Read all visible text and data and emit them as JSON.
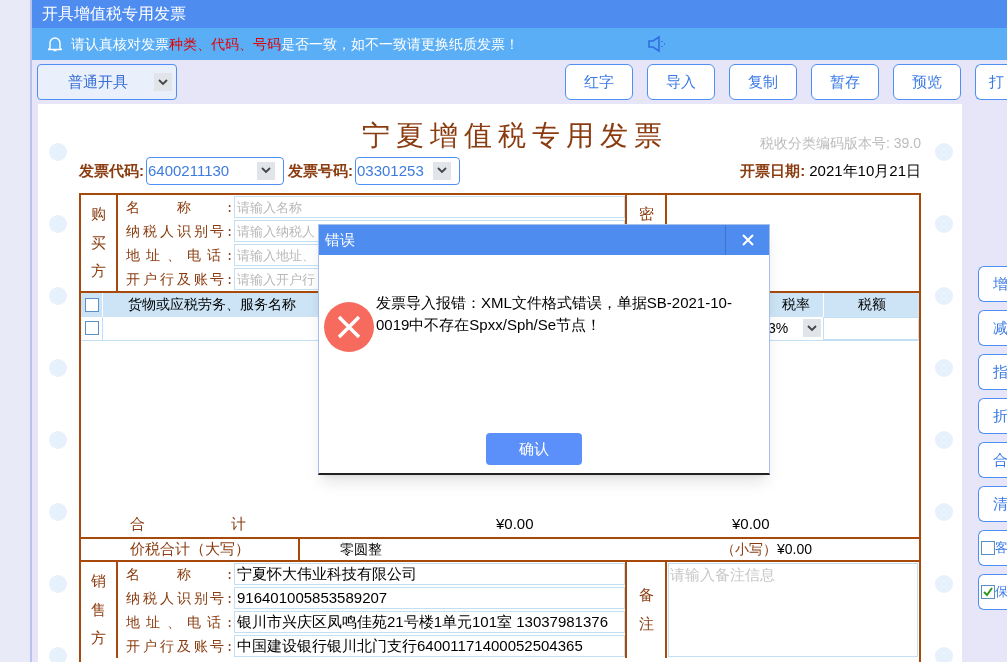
{
  "window": {
    "title": "开具增值税专用发票"
  },
  "notice": {
    "parts": [
      {
        "text": "请认真核对发票",
        "highlight": false
      },
      {
        "text": "种类、代码、号码",
        "highlight": true
      },
      {
        "text": "是否一致，如不一致请更换纸质发票！",
        "highlight": false
      }
    ]
  },
  "toolbar": {
    "mode_select": {
      "value": "普通开具"
    },
    "buttons": [
      "红字",
      "导入",
      "复制",
      "暂存",
      "预览",
      "打"
    ]
  },
  "invoice": {
    "title": "宁夏增值税专用发票",
    "version_label": "税收分类编码版本号: 39.0",
    "code_label": "发票代码:",
    "code": "6400211130",
    "number_label": "发票号码:",
    "number": "03301253",
    "date_label": "开票日期:",
    "date": "2021年10月21日",
    "buyer": {
      "heading": "购买方",
      "fields": [
        {
          "label": "名称:",
          "placeholder": "请输入名称"
        },
        {
          "label": "纳税人识别号:",
          "placeholder": "请输入纳税人"
        },
        {
          "label": "地址、电话:",
          "placeholder": "请输入地址、"
        },
        {
          "label": "开户行及账号:",
          "placeholder": "请输入开户行"
        }
      ]
    },
    "password_area_label": "密",
    "goods": {
      "columns": [
        {
          "label": "货物或应税劳务、服务名称"
        },
        {
          "label": "税率"
        },
        {
          "label": "税额"
        }
      ],
      "header_checked": false,
      "rows": [
        {
          "checked": false,
          "tax_rate": "3%"
        }
      ]
    },
    "totals": {
      "label": "合计",
      "amount": "¥0.00",
      "tax": "¥0.00"
    },
    "grand_total": {
      "label": "价税合计（大写）",
      "words": "零圆整",
      "small_label": "（小写）",
      "small": "¥0.00"
    },
    "seller": {
      "heading": "销售方",
      "fields": [
        {
          "label": "名称:",
          "value": "宁夏怀大伟业科技有限公司"
        },
        {
          "label": "纳税人识别号:",
          "value": "916401005853589207"
        },
        {
          "label": "地址、电话:",
          "value": "银川市兴庆区凤鸣佳苑21号楼1单元101室 13037981376"
        },
        {
          "label": "开户行及账号:",
          "value": "中国建设银行银川北门支行64001171400052504365"
        }
      ]
    },
    "remarks": {
      "heading": "备注",
      "placeholder": "请输入备注信息"
    }
  },
  "side_buttons": [
    {
      "kind": "button",
      "label": "增"
    },
    {
      "kind": "button",
      "label": "减"
    },
    {
      "kind": "button",
      "label": "指"
    },
    {
      "kind": "button",
      "label": "折"
    },
    {
      "kind": "button",
      "label": "合"
    },
    {
      "kind": "button",
      "label": "清"
    },
    {
      "kind": "checkbox",
      "label": "客",
      "checked": false
    },
    {
      "kind": "checkbox",
      "label": "保",
      "checked": true
    }
  ],
  "dialog": {
    "title": "错误",
    "message": "发票导入报错：XML文件格式错误，单据SB-2021-10-0019中不存在Spxx/Sph/Se节点！",
    "button": "确认"
  }
}
